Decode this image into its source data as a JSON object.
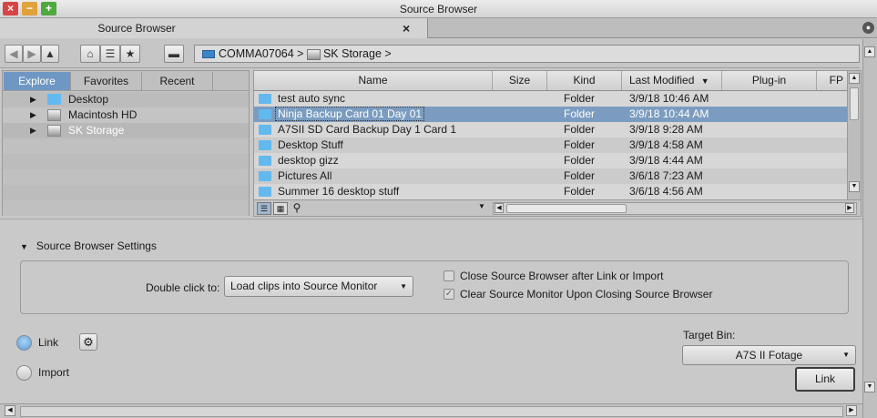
{
  "window": {
    "title": "Source Browser"
  },
  "tab": {
    "label": "Source Browser",
    "close": "×"
  },
  "toolbar": {
    "back": "◀",
    "forward": "▶",
    "up": "▲",
    "home": "⌂",
    "list": "☰",
    "favorite": "★",
    "device": "▬",
    "path_root": "COMMA07064",
    "path_sep": ">",
    "path_item": "SK Storage",
    "path_end": ">"
  },
  "left_tabs": [
    "Explore",
    "Favorites",
    "Recent"
  ],
  "tree": [
    {
      "label": "Desktop",
      "icon": "folder-icon"
    },
    {
      "label": "Macintosh HD",
      "icon": "hard-drive-icon"
    },
    {
      "label": "SK Storage",
      "icon": "hard-drive-icon"
    }
  ],
  "columns": {
    "name": "Name",
    "size": "Size",
    "kind": "Kind",
    "modified": "Last Modified",
    "sort": "▼",
    "plugin": "Plug-in",
    "fps": "FP"
  },
  "files": [
    {
      "name": "test auto sync",
      "kind": "Folder",
      "modified": "3/9/18 10:46 AM"
    },
    {
      "name": "Ninja Backup Card 01 Day 01",
      "kind": "Folder",
      "modified": "3/9/18 10:44 AM"
    },
    {
      "name": "A7SII SD Card Backup Day 1 Card 1",
      "kind": "Folder",
      "modified": "3/9/18 9:28 AM"
    },
    {
      "name": "Desktop Stuff",
      "kind": "Folder",
      "modified": "3/9/18 4:58 AM"
    },
    {
      "name": "desktop gizz",
      "kind": "Folder",
      "modified": "3/9/18 4:44 AM"
    },
    {
      "name": "Pictures All",
      "kind": "Folder",
      "modified": "3/6/18 7:23 AM"
    },
    {
      "name": "Summer 16 desktop stuff",
      "kind": "Folder",
      "modified": "3/6/18 4:56 AM"
    }
  ],
  "settings": {
    "header": "Source Browser Settings",
    "double_click_label": "Double click to:",
    "double_click_value": "Load clips into Source Monitor",
    "close_after_link": {
      "label": "Close Source Browser after Link or Import",
      "checked": false
    },
    "clear_monitor": {
      "label": "Clear Source Monitor Upon Closing Source Browser",
      "checked": true
    }
  },
  "mode": {
    "link": {
      "label": "Link",
      "selected": true
    },
    "import": {
      "label": "Import",
      "selected": false
    }
  },
  "target_bin": {
    "label": "Target Bin:",
    "value": "A7S II Fotage"
  },
  "link_button": "Link"
}
